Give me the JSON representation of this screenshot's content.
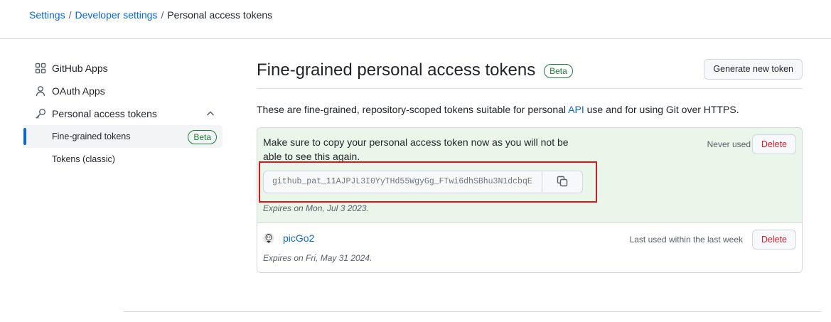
{
  "breadcrumb": {
    "items": [
      "Settings",
      "Developer settings"
    ],
    "separator": "/",
    "current": "Personal access tokens"
  },
  "sidebar": {
    "items": [
      {
        "label": "GitHub Apps",
        "icon": "apps-grid-icon"
      },
      {
        "label": "OAuth Apps",
        "icon": "person-icon"
      },
      {
        "label": "Personal access tokens",
        "icon": "key-icon",
        "expanded": true
      }
    ],
    "sub_items": [
      {
        "label": "Fine-grained tokens",
        "badge": "Beta",
        "active": true
      },
      {
        "label": "Tokens (classic)"
      }
    ]
  },
  "main": {
    "title": "Fine-grained personal access tokens",
    "title_badge": "Beta",
    "generate_button": "Generate new token",
    "description_pre": "These are fine-grained, repository-scoped tokens suitable for personal ",
    "description_link": "API",
    "description_post": " use and for using Git over HTTPS."
  },
  "tokens": {
    "new_token": {
      "notice": "Make sure to copy your personal access token now as you will not be able to see this again.",
      "status": "Never used",
      "delete_label": "Delete",
      "value": "github_pat_11AJPJL3I0YyTHd55WgyGg_FTwi6dhSBhu3N1dcbqE",
      "expires_prefix": "Expires",
      "expires_on": "on Mon, Jul 3 2023."
    },
    "existing": {
      "name": "picGo2",
      "status": "Last used within the last week",
      "delete_label": "Delete",
      "expires_prefix": "Expires",
      "expires_on": "on Fri, May 31 2024."
    }
  },
  "colors": {
    "link": "#0969da",
    "beta_green": "#1a7f37",
    "delete_red": "#cf222e",
    "notice_bg": "#eaf6ea",
    "highlight_red": "#e5141b"
  }
}
